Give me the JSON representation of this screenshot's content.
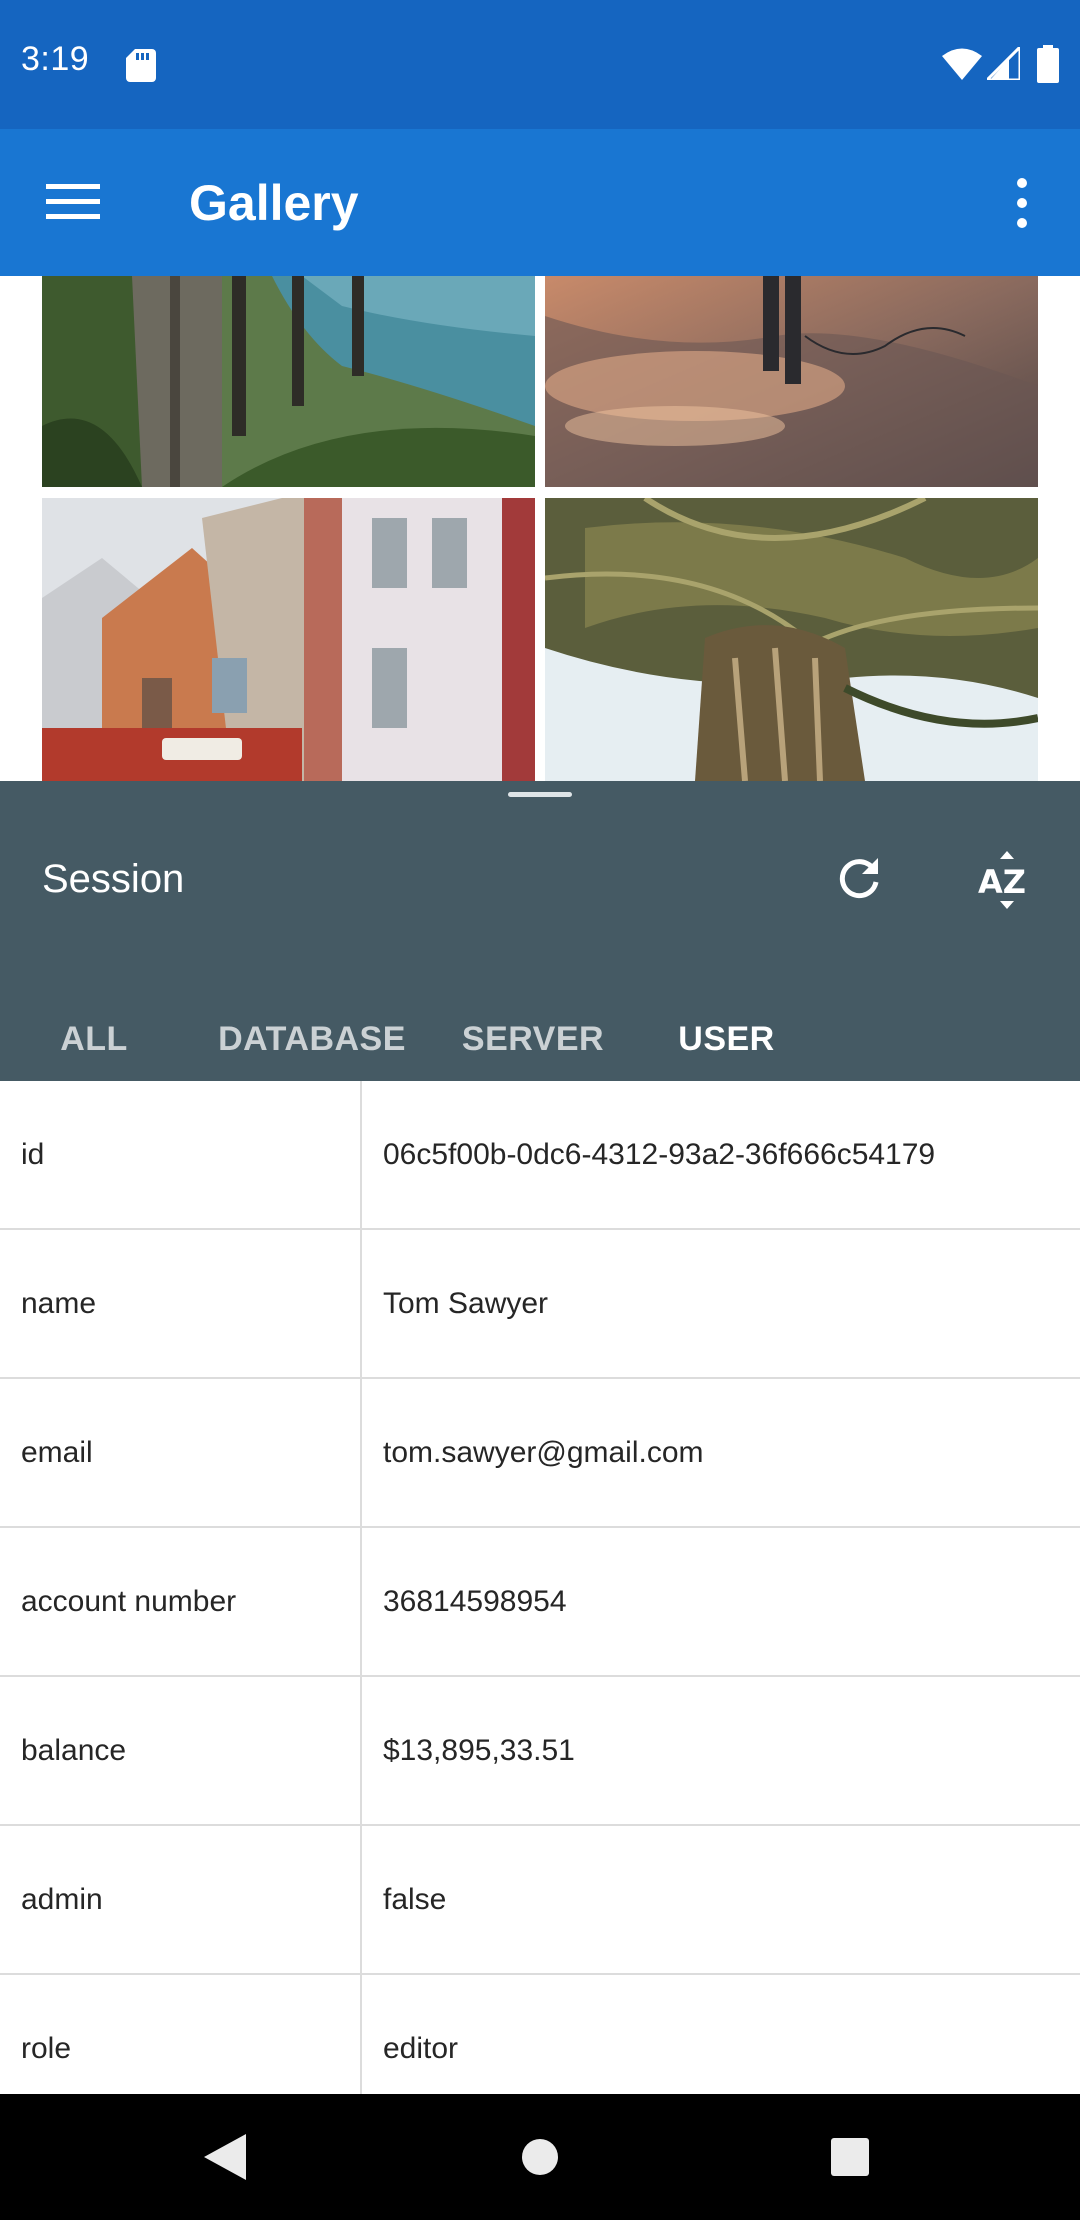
{
  "status_bar": {
    "time": "3:19",
    "icons": [
      "sd-card-icon",
      "wifi-icon",
      "signal-icon",
      "battery-icon"
    ]
  },
  "app_bar": {
    "title": "Gallery",
    "icons": [
      "menu-icon",
      "overflow-menu-icon"
    ]
  },
  "gallery": {
    "photos": [
      "cliffside-ocean-photo",
      "beach-walker-photo",
      "colorful-houses-photo",
      "palm-tree-photo"
    ]
  },
  "sheet": {
    "title": "Session",
    "icons": [
      "refresh-icon",
      "sort-az-icon"
    ],
    "tabs": [
      {
        "label": "ALL",
        "active": false
      },
      {
        "label": "DATABASE",
        "active": false
      },
      {
        "label": "SERVER",
        "active": false
      },
      {
        "label": "USER",
        "active": true
      }
    ],
    "accent_color": "#03a9f4",
    "background_color": "#455a64"
  },
  "table": {
    "rows": [
      {
        "key": "id",
        "value": "06c5f00b-0dc6-4312-93a2-36f666c54179"
      },
      {
        "key": "name",
        "value": "Tom Sawyer"
      },
      {
        "key": "email",
        "value": "tom.sawyer@gmail.com"
      },
      {
        "key": "account number",
        "value": "36814598954"
      },
      {
        "key": "balance",
        "value": "$13,895,33.51"
      },
      {
        "key": "admin",
        "value": "false"
      },
      {
        "key": "role",
        "value": "editor"
      }
    ]
  },
  "nav_bar": {
    "icons": [
      "back-icon",
      "home-icon",
      "recents-icon"
    ]
  },
  "colors": {
    "status_bar": "#1565c0",
    "app_bar": "#1976d2"
  }
}
